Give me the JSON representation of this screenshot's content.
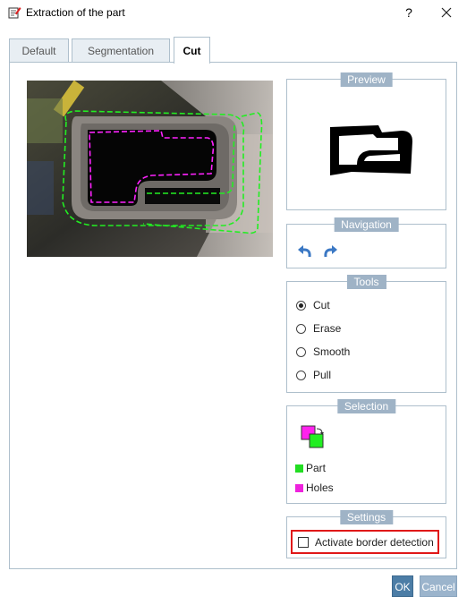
{
  "window": {
    "title": "Extraction of the part",
    "help_label": "?"
  },
  "tabs": [
    {
      "label": "Default",
      "active": false
    },
    {
      "label": "Segmentation",
      "active": false
    },
    {
      "label": "Cut",
      "active": true
    }
  ],
  "preview": {
    "title": "Preview"
  },
  "navigation": {
    "title": "Navigation",
    "icons": [
      "undo-icon",
      "redo-icon"
    ]
  },
  "tools": {
    "title": "Tools",
    "options": [
      {
        "label": "Cut",
        "selected": true
      },
      {
        "label": "Erase",
        "selected": false
      },
      {
        "label": "Smooth",
        "selected": false
      },
      {
        "label": "Pull",
        "selected": false
      }
    ]
  },
  "selection": {
    "title": "Selection",
    "legend": [
      {
        "label": "Part",
        "color": "#22dd22"
      },
      {
        "label": "Holes",
        "color": "#ee22dd"
      }
    ]
  },
  "settings": {
    "title": "Settings",
    "checkbox_label": "Activate border detection",
    "checked": false
  },
  "footer": {
    "ok_label": "OK",
    "cancel_label": "Cancel"
  },
  "colors": {
    "accent": "#9fb3c6",
    "ok_button": "#4c7da6",
    "highlight": "#e01818"
  }
}
